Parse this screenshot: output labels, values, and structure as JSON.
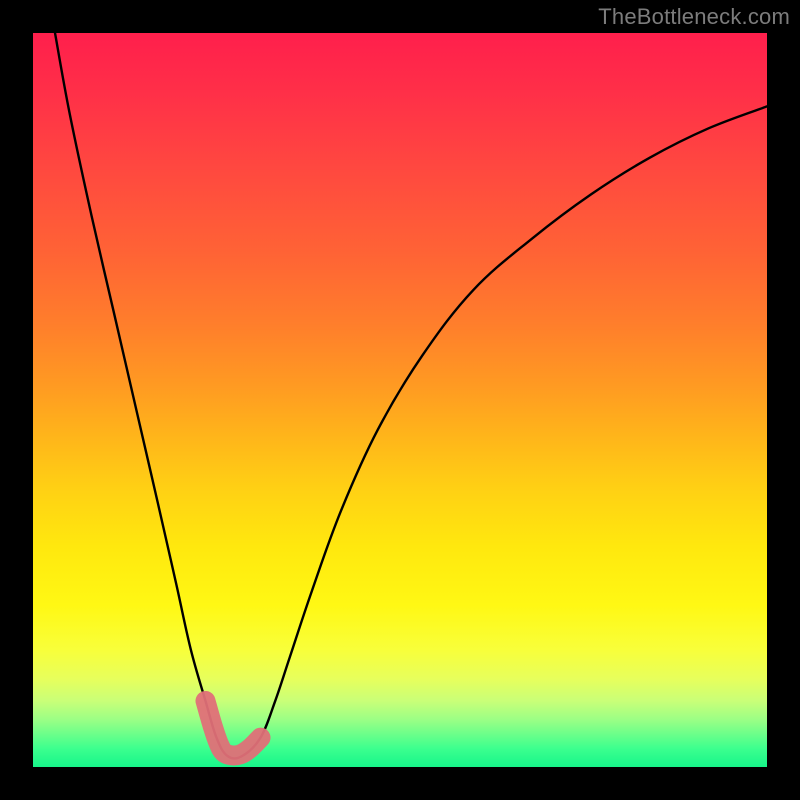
{
  "watermark": "TheBottleneck.com",
  "chart_data": {
    "type": "line",
    "title": "",
    "xlabel": "",
    "ylabel": "",
    "xlim": [
      0,
      100
    ],
    "ylim": [
      0,
      100
    ],
    "grid": false,
    "legend": false,
    "series": [
      {
        "name": "bottleneck-curve",
        "x": [
          3,
          5,
          8,
          11,
          14,
          17,
          19.5,
          21.5,
          23.5,
          25,
          26.5,
          28.5,
          31,
          33,
          35,
          38,
          42,
          47,
          53,
          60,
          68,
          76,
          84,
          92,
          100
        ],
        "values": [
          100,
          89,
          75,
          62,
          49,
          36,
          25,
          16,
          9,
          4,
          1.5,
          1.5,
          4,
          9,
          15,
          24,
          35,
          46,
          56,
          65,
          72,
          78,
          83,
          87,
          90
        ]
      }
    ],
    "highlight_segment": {
      "name": "optimal-zone",
      "x": [
        23.5,
        24.5,
        25.3,
        26.0,
        27.0,
        28.2,
        29.5,
        31.0
      ],
      "values": [
        9.0,
        5.5,
        3.2,
        2.0,
        1.6,
        1.7,
        2.5,
        4.0
      ]
    },
    "background_gradient": {
      "top": "#ff1f4c",
      "mid": "#ffe80e",
      "bottom": "#17f58a"
    }
  }
}
